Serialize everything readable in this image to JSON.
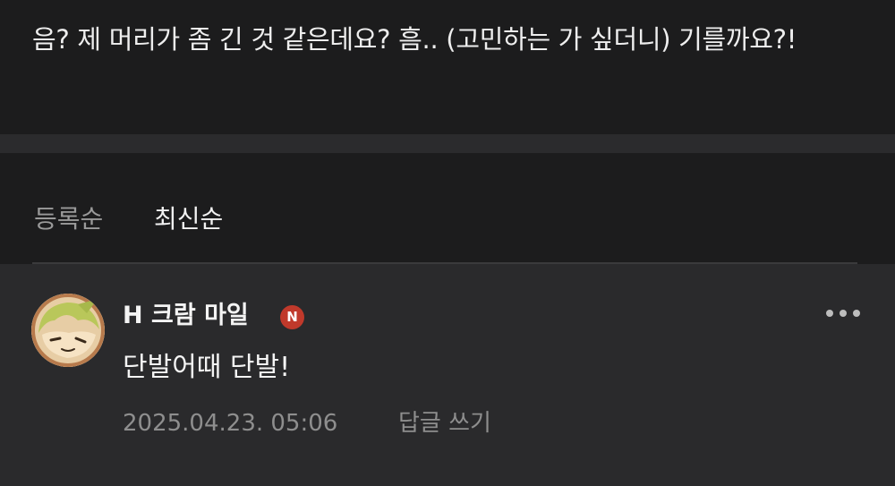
{
  "post": {
    "text": "음? 제 머리가 좀 긴 것 같은데요? 흠.. (고민하는 가 싶더니) 기를까요?!"
  },
  "sort": {
    "tabs": [
      {
        "label": "등록순",
        "active": false
      },
      {
        "label": "최신순",
        "active": true
      }
    ]
  },
  "comment": {
    "nickname": "H 크람 마일",
    "badge": "N",
    "text": "단발어때 단발!",
    "timestamp": "2025.04.23. 05:06",
    "reply_label": "답글 쓰기",
    "more_icon": "more-horizontal-icon",
    "avatar_icon": "avatar-character-icon"
  },
  "colors": {
    "background": "#1c1c1d",
    "separator": "#2b2b2d",
    "comment_bg": "#2a2a2c",
    "badge": "#c0392b"
  }
}
